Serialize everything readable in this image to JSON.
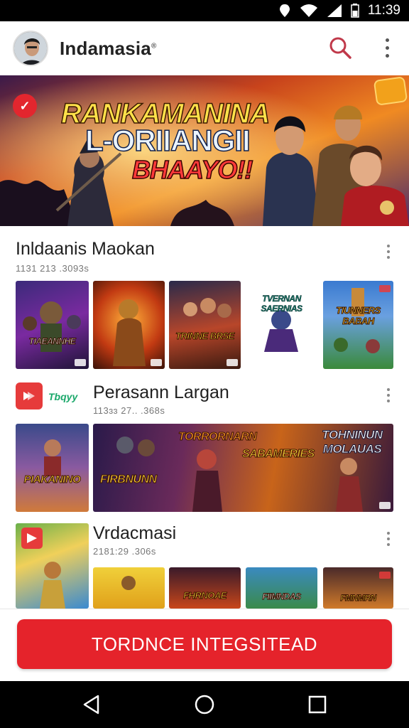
{
  "status_bar": {
    "time": "11:39"
  },
  "app_bar": {
    "title": "Indamasia",
    "title_mark": "®"
  },
  "banner": {
    "line1": "RANKAMANINA",
    "line2": "L-ORIIANGII",
    "line3": "BHAAYO!!"
  },
  "sections": [
    {
      "title": "Inldaanis Maokan",
      "subtitle": "1131 213 .3093s",
      "tiles": [
        "TIAEANNHE",
        "",
        "TRINNE BRSE",
        "TVERNAN SAERNIAS",
        "TIUNNERS BABAH"
      ]
    },
    {
      "title": "Perasann Largan",
      "subtitle": "113ɜɜ 27.. .368s",
      "icon_label": "Tbqyy",
      "tiles": [
        "PIAKANINO",
        "FIRBNUNN",
        "TORRORNARN",
        "SABAMERIES",
        "TOHNINUN MOLAUAS"
      ]
    },
    {
      "title": "Vrdacmasi",
      "subtitle": "2181:29 .306s",
      "tiles": [
        "",
        "FHRNOAE",
        "FIIMNDAS",
        "",
        "FMNMRN"
      ]
    }
  ],
  "cta": {
    "label": "TORDNCE INTEGSITEAD"
  },
  "colors": {
    "accent": "#e5232b",
    "text": "#202020",
    "subtext": "#777777"
  }
}
